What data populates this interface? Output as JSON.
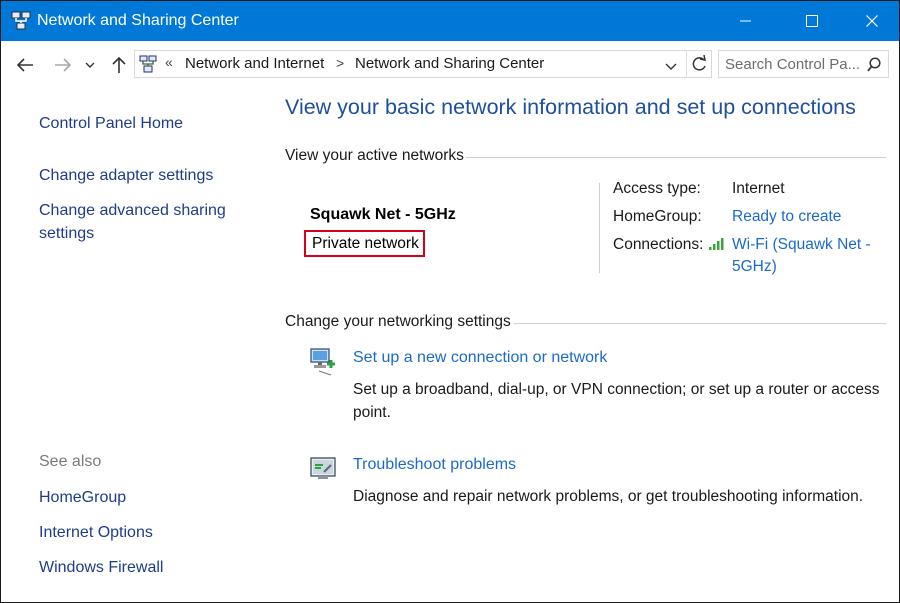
{
  "window": {
    "title": "Network and Sharing Center",
    "controls": [
      "minimize",
      "maximize",
      "close"
    ]
  },
  "address_bar": {
    "overflow_marker": "«",
    "breadcrumbs": [
      "Network and Internet",
      "Network and Sharing Center"
    ],
    "separator": ">"
  },
  "search": {
    "placeholder": "Search Control Pa..."
  },
  "sidebar": {
    "home_link": "Control Panel Home",
    "links": [
      "Change adapter settings",
      "Change advanced sharing settings"
    ],
    "see_also_heading": "See also",
    "see_also_links": [
      "HomeGroup",
      "Internet Options",
      "Windows Firewall"
    ]
  },
  "main": {
    "heading": "View your basic network information and set up connections",
    "active_networks_label": "View your active networks",
    "network": {
      "name": "Squawk Net - 5GHz",
      "category": "Private network",
      "access_type_label": "Access type:",
      "access_type_value": "Internet",
      "homegroup_label": "HomeGroup:",
      "homegroup_value": "Ready to create",
      "connections_label": "Connections:",
      "connections_value_line1": "Wi-Fi (Squawk Net -",
      "connections_value_line2": "5GHz)"
    },
    "change_settings_label": "Change your networking settings",
    "tasks": [
      {
        "icon": "new-connection-icon",
        "title": "Set up a new connection or network",
        "description": "Set up a broadband, dial-up, or VPN connection; or set up a router or access point."
      },
      {
        "icon": "troubleshoot-icon",
        "title": "Troubleshoot problems",
        "description": "Diagnose and repair network problems, or get troubleshooting information."
      }
    ]
  },
  "colors": {
    "titlebar": "#0078d7",
    "link": "#1b6ac9",
    "heading": "#1e4f9c",
    "highlight_box": "#d6001c",
    "signal": "#3aa53a"
  }
}
